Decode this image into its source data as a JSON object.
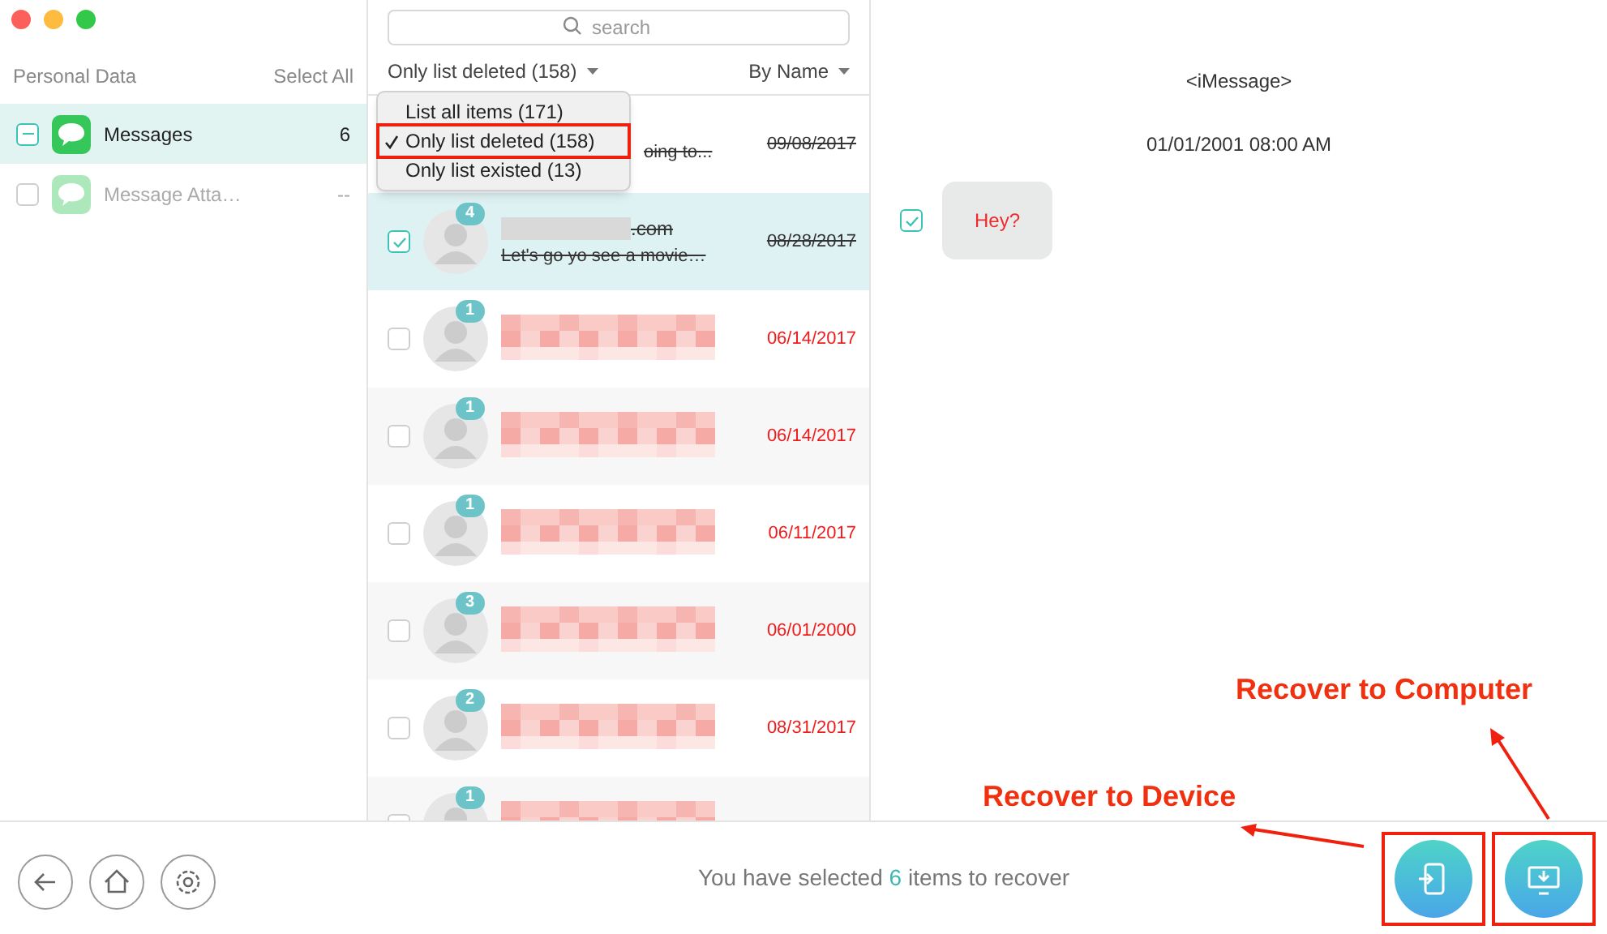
{
  "sidebar": {
    "header": "Personal Data",
    "select_all": "Select All",
    "items": [
      {
        "label": "Messages",
        "count": "6",
        "selected": true,
        "partial": true,
        "disabled": false
      },
      {
        "label": "Message Atta…",
        "count": "--",
        "selected": false,
        "partial": false,
        "disabled": true
      }
    ]
  },
  "list": {
    "search": {
      "placeholder": "search"
    },
    "filter": "Only list deleted (158)",
    "sort": "By Name",
    "dropdown": [
      {
        "label": "List all items (171)",
        "selected": false,
        "highlighted": false
      },
      {
        "label": "Only list deleted (158)",
        "selected": true,
        "highlighted": true
      },
      {
        "label": "Only list existed (13)",
        "selected": false,
        "highlighted": false
      }
    ],
    "rows": [
      {
        "kind": "covered",
        "preview": "oing to...",
        "date": "09/08/2017",
        "deleted": true,
        "selected": false
      },
      {
        "kind": "contact",
        "badge": "4",
        "name_tail": ".com",
        "preview": "Let's go yo see a movie…",
        "date": "08/28/2017",
        "deleted": true,
        "checked": true,
        "selected": true
      },
      {
        "kind": "contact",
        "badge": "1",
        "date": "06/14/2017",
        "deleted": false,
        "checked": false,
        "selected": false
      },
      {
        "kind": "contact",
        "badge": "1",
        "date": "06/14/2017",
        "deleted": false,
        "checked": false,
        "selected": false
      },
      {
        "kind": "contact",
        "badge": "1",
        "date": "06/11/2017",
        "deleted": false,
        "checked": false,
        "selected": false
      },
      {
        "kind": "contact",
        "badge": "3",
        "date": "06/01/2000",
        "deleted": false,
        "checked": false,
        "selected": false
      },
      {
        "kind": "contact",
        "badge": "2",
        "date": "08/31/2017",
        "deleted": false,
        "checked": false,
        "selected": false
      },
      {
        "kind": "contact",
        "badge": "1",
        "checked": false,
        "selected": false
      }
    ]
  },
  "detail": {
    "title": "<iMessage>",
    "time": "01/01/2001 08:00 AM",
    "messages": [
      {
        "text": "Hey?",
        "checked": true
      }
    ]
  },
  "status": {
    "before": "You have selected",
    "count": "6",
    "after": "items to recover"
  },
  "annotations": [
    {
      "label": "Recover to Computer"
    },
    {
      "label": "Recover to Device"
    }
  ]
}
